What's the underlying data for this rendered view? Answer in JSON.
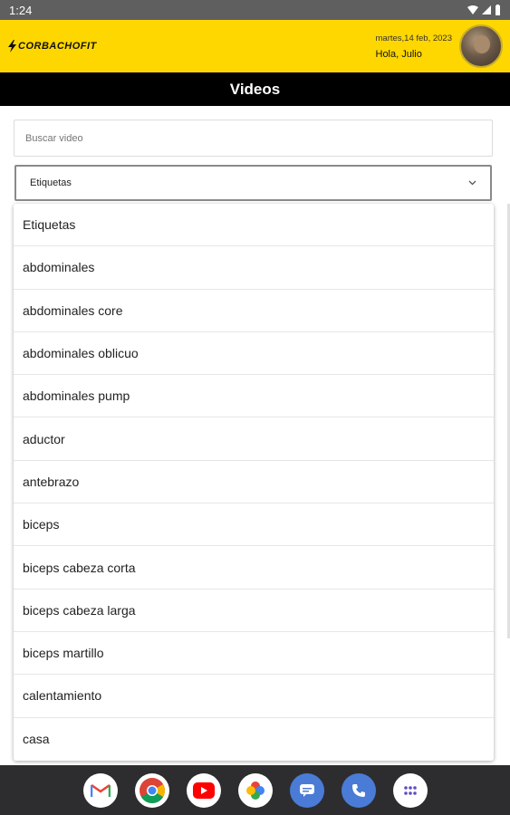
{
  "status": {
    "time": "1:24"
  },
  "header": {
    "logo": "CORBACHOFIT",
    "date": "martes,14 feb, 2023",
    "greeting": "Hola, Julio"
  },
  "title": "Videos",
  "search": {
    "placeholder": "Buscar video"
  },
  "select": {
    "value": "Etiquetas"
  },
  "options": [
    "Etiquetas",
    "abdominales",
    "abdominales core",
    "abdominales oblicuo",
    "abdominales pump",
    "aductor",
    "antebrazo",
    "biceps",
    "biceps cabeza corta",
    "biceps cabeza larga",
    "biceps martillo",
    "calentamiento",
    "casa"
  ],
  "nav_apps": [
    "gmail-icon",
    "chrome-icon",
    "youtube-icon",
    "photos-icon",
    "messages-icon",
    "phone-icon",
    "app-drawer-icon"
  ],
  "colors": {
    "brand": "#ffd700",
    "title_bar": "#000000"
  }
}
